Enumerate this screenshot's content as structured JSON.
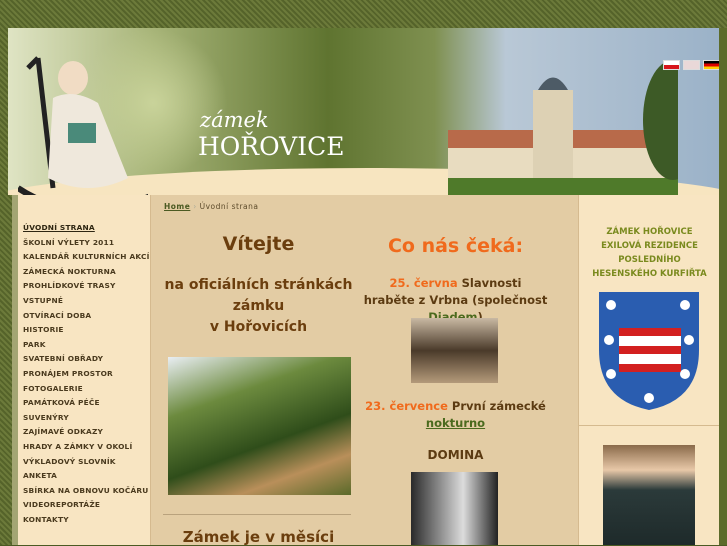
{
  "header": {
    "logo_small": "zámek",
    "logo_big": "HOŘOVICE",
    "languages": [
      "Čeština",
      "English",
      "Deutsch"
    ]
  },
  "sidebar": {
    "items": [
      "ÚVODNÍ STRANA",
      "ŠKOLNÍ VÝLETY 2011",
      "KALENDÁŘ KULTURNÍCH AKCÍ",
      "ZÁMECKÁ NOKTURNA",
      "PROHLÍDKOVÉ TRASY",
      "VSTUPNÉ",
      "OTVÍRACÍ DOBA",
      "HISTORIE",
      "PARK",
      "SVATEBNÍ OBŘADY",
      "PRONÁJEM PROSTOR",
      "FOTOGALERIE",
      "PAMÁTKOVÁ PÉČE",
      "SUVENÝRY",
      "ZAJÍMAVÉ ODKAZY",
      "HRADY A ZÁMKY V OKOLÍ",
      "VÝKLADOVÝ SLOVNÍK",
      "ANKETA",
      "SBÍRKA NA OBNOVU KOČÁRU",
      "VIDEOREPORTÁŽE",
      "KONTAKTY"
    ]
  },
  "breadcrumb": {
    "home": "Home",
    "separator": "›",
    "current": "Úvodní strana"
  },
  "welcome": {
    "title": "Vítejte",
    "line1": "na oficiálních stránkách",
    "line2": "zámku",
    "line3": "v Hořovicích",
    "month_title": "Zámek je v měsíci"
  },
  "events": {
    "title": "Co nás čeká:",
    "e1_date": "25. června",
    "e1_text": "Slavnosti hraběte z Vrbna (společnost",
    "e1_link": "Diadem",
    "e1_end": ")",
    "e2_date": "23. července",
    "e2_text": "První zámecké",
    "e2_link": "nokturno",
    "e3_title": "DOMINA"
  },
  "right": {
    "line1": "ZÁMEK HOŘOVICE",
    "line2": "EXILOVÁ REZIDENCE",
    "line3": "POSLEDNÍHO",
    "line4": "HESENSKÉHO KURFIŘTA"
  }
}
